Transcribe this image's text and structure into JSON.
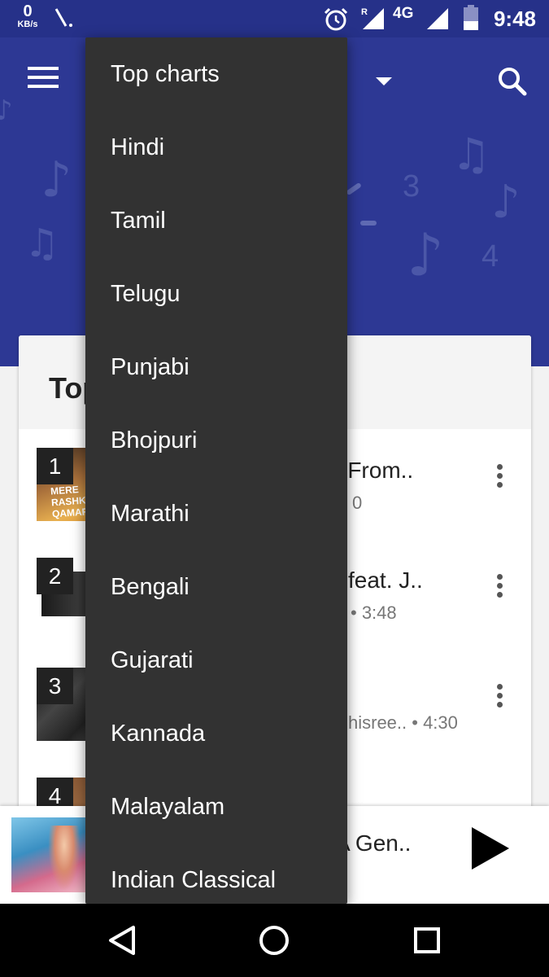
{
  "status_bar": {
    "net_speed": "0",
    "net_unit": "KB/s",
    "roaming": "R",
    "network": "4G",
    "time": "9:48",
    "icons": [
      "unknown-notification-icon",
      "alarm-icon",
      "signal-icon",
      "battery-icon"
    ]
  },
  "header": {
    "decor_digits": [
      "3",
      "4"
    ],
    "icons": [
      "menu-icon",
      "dropdown-arrow-icon",
      "search-icon"
    ]
  },
  "card": {
    "title": "Top",
    "rows": [
      {
        "rank": "1",
        "title": "(From..",
        "subtitle": "0"
      },
      {
        "rank": "2",
        "title": "feat. J..",
        "subtitle": "• 3:48"
      },
      {
        "rank": "3",
        "title": "",
        "subtitle": "hisree..  • 4:30"
      },
      {
        "rank": "4",
        "title": "",
        "subtitle": ""
      }
    ]
  },
  "album_text": {
    "row1": "MERE RASHKE QAMAR"
  },
  "player": {
    "title": "A Gen.."
  },
  "dropdown": {
    "items": [
      "Top charts",
      "Hindi",
      "Tamil",
      "Telugu",
      "Punjabi",
      "Bhojpuri",
      "Marathi",
      "Bengali",
      "Gujarati",
      "Kannada",
      "Malayalam",
      "Indian Classical"
    ]
  },
  "navbar": {
    "icons": [
      "back-icon",
      "home-icon",
      "recents-icon"
    ]
  },
  "colors": {
    "header": "#2d3894",
    "status_bar": "#263189",
    "menu_bg": "#323232"
  }
}
